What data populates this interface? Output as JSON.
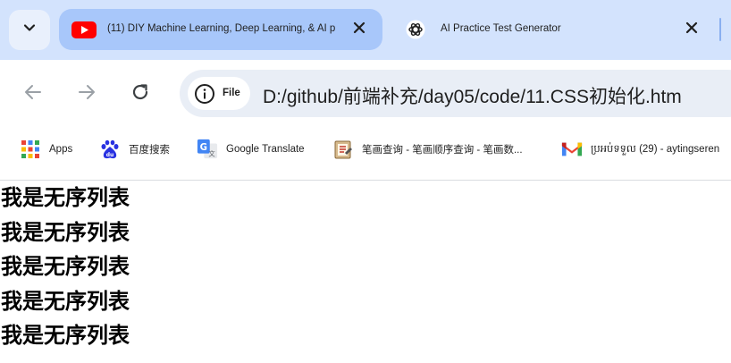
{
  "tabs": [
    {
      "title": "(11) DIY Machine Learning, Deep Learning, & AI p",
      "icon": "youtube-icon",
      "active": true
    },
    {
      "title": "AI Practice Test Generator",
      "icon": "openai-icon",
      "active": false
    }
  ],
  "address_bar": {
    "site_info_label": "File",
    "url": "D:/github/前端补充/day05/code/11.CSS初始化.htm"
  },
  "bookmarks": [
    {
      "label": "Apps",
      "icon": "apps-grid-icon"
    },
    {
      "label": "百度搜索",
      "icon": "baidu-icon"
    },
    {
      "label": "Google Translate",
      "icon": "google-translate-icon"
    },
    {
      "label": "笔画查询 - 笔画顺序查询 - 笔画数...",
      "icon": "bihua-icon"
    },
    {
      "label": "ប្រអប់ទទួល (29) - aytingseren",
      "icon": "gmail-icon"
    }
  ],
  "content": {
    "items": [
      "我是无序列表",
      "我是无序列表",
      "我是无序列表",
      "我是无序列表",
      "我是无序列表"
    ]
  },
  "colors": {
    "tabstrip_bg": "#d3e3fd",
    "active_tab_bg": "#a8c7fa",
    "omnibox_bg": "#e9eef6",
    "youtube_red": "#ff0000"
  }
}
